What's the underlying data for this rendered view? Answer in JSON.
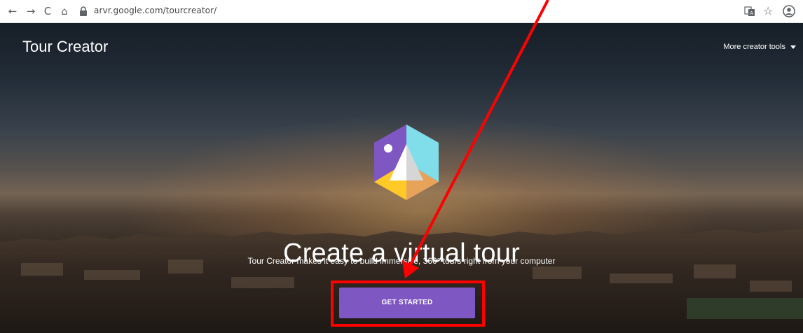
{
  "browser": {
    "back_icon": "←",
    "forward_icon": "→",
    "reload_icon": "C",
    "home_icon": "⌂",
    "url": "arvr.google.com/tourcreator/",
    "star_icon": "☆"
  },
  "header": {
    "brand": "Tour Creator",
    "more_tools_label": "More creator tools"
  },
  "hero": {
    "headline": "Create a virtual tour",
    "subtitle": "Tour Creator makes it easy to build immersive, 360° tours right from your computer",
    "cta_label": "GET STARTED"
  },
  "colors": {
    "cta": "#7e57c2",
    "annotation": "#ff0000"
  }
}
